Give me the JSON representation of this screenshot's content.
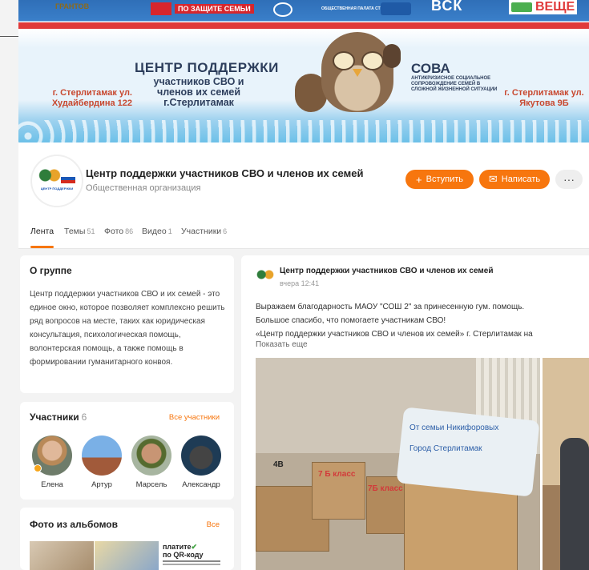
{
  "banner": {
    "partners": {
      "p1": "ГРАНТОВ",
      "p2": "ПО ЗАЩИТЕ СЕМЬИ",
      "p4": "ОБЩЕСТВЕННАЯ ПАЛАТА СТЕРЛИТАМАК",
      "p6": "ВСК",
      "p7": "ВЕЩЕ"
    },
    "title": "ЦЕНТР ПОДДЕРЖКИ",
    "subtitle": "участников СВО и членов их семей г.Стерлитамак",
    "address_left": "г. Стерлитамак ул. Худайбердина 122",
    "sova_title": "СОВА",
    "sova_subtitle": "АНТИКРИЗИСНОЕ СОЦИАЛЬНОЕ СОПРОВОЖДЕНИЕ СЕМЕЙ В СЛОЖНОЙ ЖИЗНЕННОЙ СИТУАЦИИ",
    "address_right": "г. Стерлитамак ул. Якутова 9Б"
  },
  "group": {
    "logo_caption": "ЦЕНТР ПОДДЕРЖКИ",
    "name": "Центр поддержки участников СВО и членов их семей",
    "type": "Общественная организация",
    "join_label": "Вступить",
    "join_icon": "+",
    "message_label": "Написать",
    "message_icon": "message-icon",
    "more_label": "···"
  },
  "tabs": [
    {
      "label": "Лента",
      "count": ""
    },
    {
      "label": "Темы",
      "count": "51"
    },
    {
      "label": "Фото",
      "count": "86"
    },
    {
      "label": "Видео",
      "count": "1"
    },
    {
      "label": "Участники",
      "count": "6"
    }
  ],
  "about": {
    "title": "О группе",
    "text": "Центр поддержки участников СВО и их семей - это единое окно, которое позволяет комплексно решить ряд вопросов на месте, таких как юридическая консультация, психологическая помощь, волонтерская помощь, а также помощь в формировании гуманитарного конвоя."
  },
  "members": {
    "title": "Участники",
    "count": "6",
    "all_label": "Все участники",
    "items": [
      {
        "name": "Елена"
      },
      {
        "name": "Артур"
      },
      {
        "name": "Марсель"
      },
      {
        "name": "Александр"
      }
    ]
  },
  "photos": {
    "title": "Фото из альбомов",
    "all_label": "Все",
    "thumb_text_1": "платите",
    "thumb_text_2": "по QR-коду"
  },
  "post": {
    "author": "Центр поддержки участников СВО и членов их семей",
    "time": "вчера 12:41",
    "line1": "Выражаем благодарность МАОУ \"СОШ 2\" за принесенную гум. помощь.",
    "line2": "Большое спасибо, что помогаете участникам СВО!",
    "line3": "«Центр поддержки участников СВО и членов их семей» г. Стерлитамак на",
    "more_label": "Показать еще",
    "photo_labels": [
      "4В",
      "7 Б класс",
      "7Б класс",
      "От семьи Никифоровых",
      "Город Стерлитамак"
    ]
  },
  "colors": {
    "accent": "#f7760e",
    "background": "#f3f3f3"
  }
}
